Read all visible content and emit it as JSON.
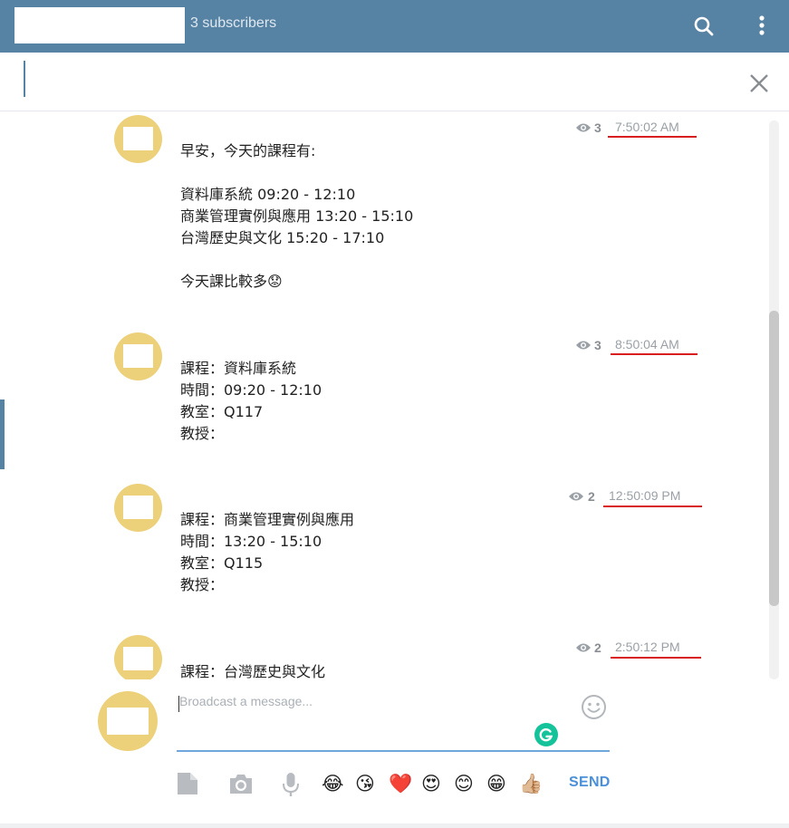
{
  "header": {
    "subscribers": "3 subscribers",
    "icons": [
      "search-icon",
      "more-vertical-icon"
    ]
  },
  "search": {
    "value": "",
    "close_icon": "close-icon"
  },
  "messages": [
    {
      "views": "3",
      "time": "7:50:02 AM",
      "text": "早安，今天的課程有:\n\n資料庫系統 09:20 - 12:10\n商業管理實例與應用 13:20 - 15:10\n台灣歷史與文化 15:20 - 17:10\n\n今天課比較多😟"
    },
    {
      "views": "3",
      "time": "8:50:04 AM",
      "text": "課程：資料庫系統\n時間：09:20 - 12:10\n教室：Q117\n教授："
    },
    {
      "views": "2",
      "time": "12:50:09 PM",
      "text": "課程：商業管理實例與應用\n時間：13:20 - 15:10\n教室：Q115\n教授："
    },
    {
      "views": "2",
      "time": "2:50:12 PM",
      "text": "課程：台灣歷史與文化"
    }
  ],
  "composer": {
    "placeholder": "Broadcast a message...",
    "value": "",
    "send_label": "SEND",
    "tools": [
      "file-icon",
      "camera-icon",
      "microphone-icon",
      "smiley-icon"
    ],
    "quick_emojis": [
      "😂",
      "😘",
      "❤️",
      "😍",
      "😊",
      "😁",
      "👍🏼"
    ]
  },
  "colors": {
    "header_bg": "#5682a3",
    "avatar": "#ecd17a",
    "annotation_underline": "#d81e1e",
    "send": "#4a90d9",
    "grammarly": "#15c39a"
  }
}
